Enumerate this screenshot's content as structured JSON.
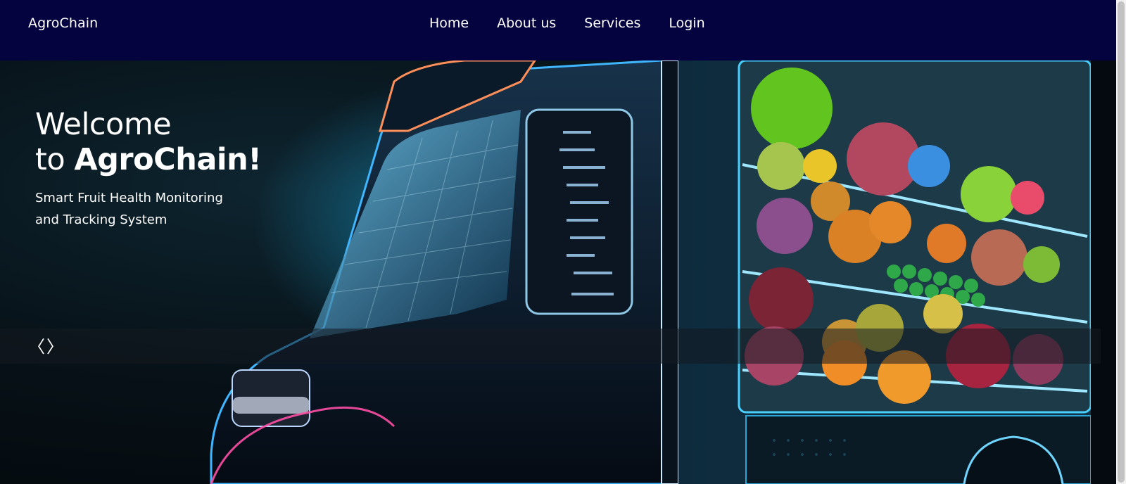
{
  "header": {
    "brand": "AgroChain",
    "nav": [
      {
        "label": "Home"
      },
      {
        "label": "About us"
      },
      {
        "label": "Services"
      },
      {
        "label": "Login"
      }
    ]
  },
  "hero": {
    "headline_line1": "Welcome",
    "headline_line2_prefix": "to ",
    "headline_line2_brand": "AgroChain!",
    "subtitle_line1": "Smart Fruit Health Monitoring",
    "subtitle_line2": "and Tracking System",
    "prev_arrow": "〈",
    "next_arrow": "〉",
    "image_icon": "produce-truck-illustration"
  },
  "colors": {
    "header_bg": "#05033f",
    "text": "#ffffff"
  }
}
